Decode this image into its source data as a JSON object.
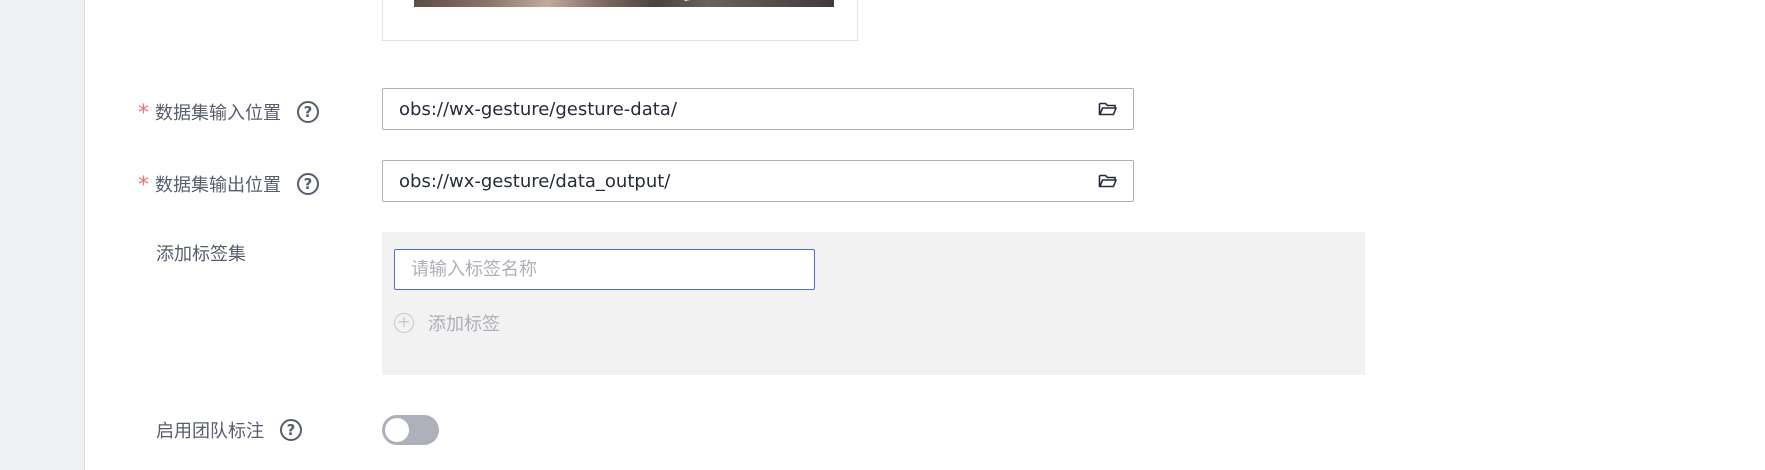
{
  "form": {
    "input_location": {
      "label": "数据集输入位置",
      "required_mark": "*",
      "value": "obs://wx-gesture/gesture-data/"
    },
    "output_location": {
      "label": "数据集输出位置",
      "required_mark": "*",
      "value": "obs://wx-gesture/data_output/"
    },
    "tag_set": {
      "label": "添加标签集",
      "input_placeholder": "请输入标签名称",
      "add_tag_label": "添加标签"
    },
    "team_labeling": {
      "label": "启用团队标注",
      "enabled": false
    },
    "help_glyph": "?"
  },
  "icons": {
    "folder": "folder-open-icon",
    "help": "help-circle-icon",
    "add": "plus-circle-icon"
  },
  "colors": {
    "required": "#f66f6a",
    "input_focus_border": "#526ecc",
    "toggle_off": "#adb0b8",
    "panel_bg": "#f2f2f2"
  }
}
